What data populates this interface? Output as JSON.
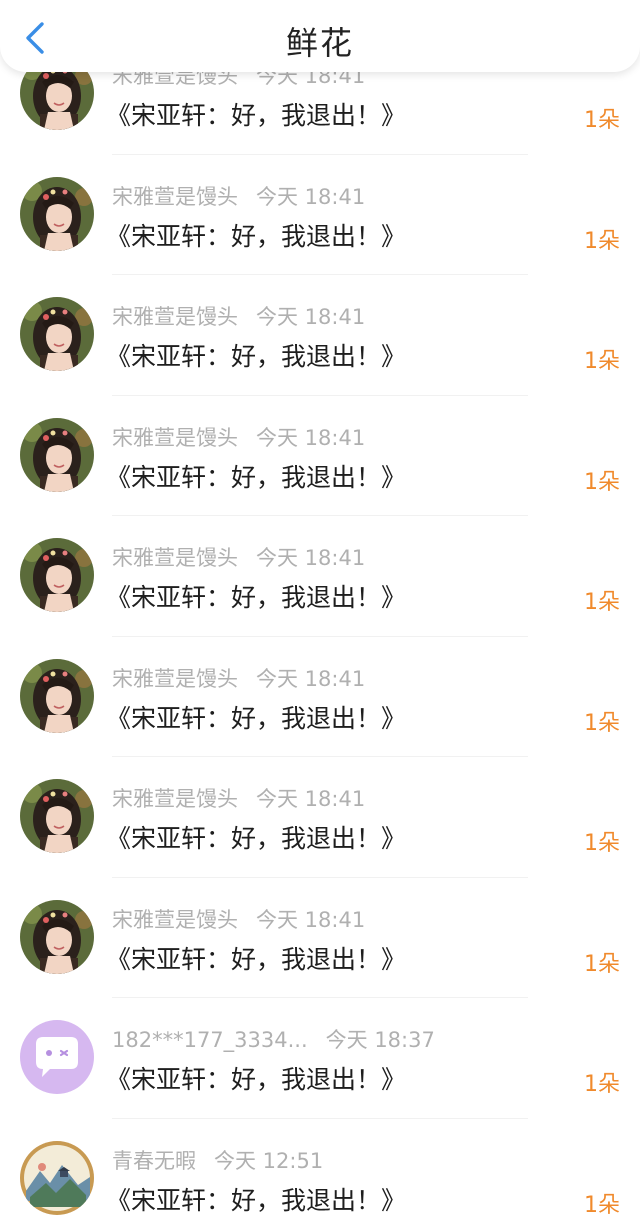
{
  "header": {
    "title": "鲜花",
    "back_icon": "chevron-left-icon",
    "accent_color": "#3a8ee6"
  },
  "count_color": "#f08a2c",
  "rows": [
    {
      "name": "宋雅萱是馒头",
      "time": "今天 18:41",
      "message": "《宋亚轩：好，我退出！》",
      "count": "1朵",
      "avatar": "girl-photo"
    },
    {
      "name": "宋雅萱是馒头",
      "time": "今天 18:41",
      "message": "《宋亚轩：好，我退出！》",
      "count": "1朵",
      "avatar": "girl-photo"
    },
    {
      "name": "宋雅萱是馒头",
      "time": "今天 18:41",
      "message": "《宋亚轩：好，我退出！》",
      "count": "1朵",
      "avatar": "girl-photo"
    },
    {
      "name": "宋雅萱是馒头",
      "time": "今天 18:41",
      "message": "《宋亚轩：好，我退出！》",
      "count": "1朵",
      "avatar": "girl-photo"
    },
    {
      "name": "宋雅萱是馒头",
      "time": "今天 18:41",
      "message": "《宋亚轩：好，我退出！》",
      "count": "1朵",
      "avatar": "girl-photo"
    },
    {
      "name": "宋雅萱是馒头",
      "time": "今天 18:41",
      "message": "《宋亚轩：好，我退出！》",
      "count": "1朵",
      "avatar": "girl-photo"
    },
    {
      "name": "宋雅萱是馒头",
      "time": "今天 18:41",
      "message": "《宋亚轩：好，我退出！》",
      "count": "1朵",
      "avatar": "girl-photo"
    },
    {
      "name": "宋雅萱是馒头",
      "time": "今天 18:41",
      "message": "《宋亚轩：好，我退出！》",
      "count": "1朵",
      "avatar": "girl-photo"
    },
    {
      "name": "182***177_3334...",
      "time": "今天 18:37",
      "message": "《宋亚轩：好，我退出！》",
      "count": "1朵",
      "avatar": "chat-bubble-default"
    },
    {
      "name": "青春无暇",
      "time": "今天 12:51",
      "message": "《宋亚轩：好，我退出！》",
      "count": "1朵",
      "avatar": "landscape-painting"
    }
  ]
}
